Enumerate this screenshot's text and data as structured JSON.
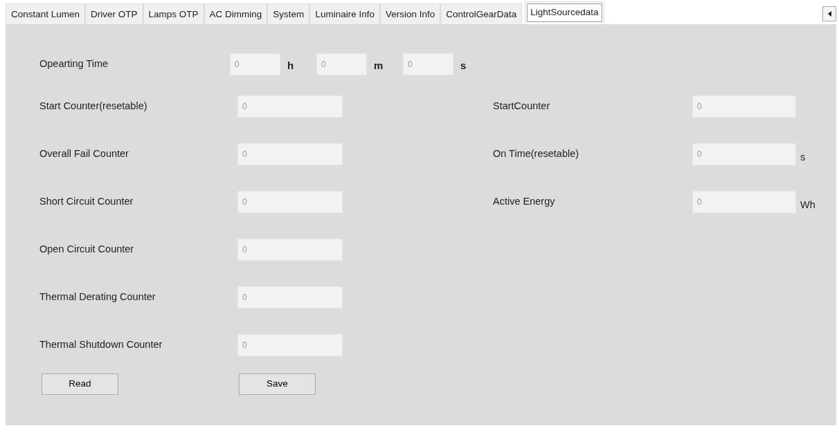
{
  "tabs": [
    {
      "label": "Constant Lumen",
      "selected": false
    },
    {
      "label": "Driver OTP",
      "selected": false
    },
    {
      "label": "Lamps OTP",
      "selected": false
    },
    {
      "label": "AC Dimming",
      "selected": false
    },
    {
      "label": "System",
      "selected": false
    },
    {
      "label": "Luminaire Info",
      "selected": false
    },
    {
      "label": "Version Info",
      "selected": false
    },
    {
      "label": "ControlGearData",
      "selected": false
    },
    {
      "label": "LightSourcedata",
      "selected": true
    }
  ],
  "operating_time": {
    "label": "Opearting Time",
    "parts": [
      {
        "value": "0",
        "unit": "h"
      },
      {
        "value": "0",
        "unit": "m"
      },
      {
        "value": "0",
        "unit": "s"
      }
    ]
  },
  "left_fields": [
    {
      "label": "Start Counter(resetable)",
      "value": "0"
    },
    {
      "label": "Overall Fail Counter",
      "value": "0"
    },
    {
      "label": "Short Circuit Counter",
      "value": "0"
    },
    {
      "label": "Open Circuit Counter",
      "value": "0"
    },
    {
      "label": "Thermal Derating Counter",
      "value": "0"
    },
    {
      "label": "Thermal Shutdown Counter",
      "value": "0"
    }
  ],
  "right_fields": [
    {
      "label": "StartCounter",
      "value": "0"
    },
    {
      "label": "On Time(resetable)",
      "value": "0",
      "unit": "s"
    },
    {
      "label": "Active Energy",
      "value": "0",
      "unit": "Wh"
    }
  ],
  "buttons": [
    "Read",
    "Save"
  ]
}
